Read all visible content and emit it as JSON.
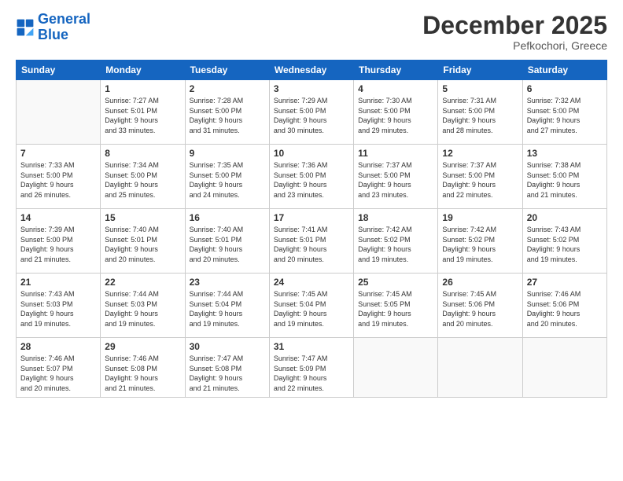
{
  "logo": {
    "line1": "General",
    "line2": "Blue"
  },
  "title": "December 2025",
  "location": "Pefkochori, Greece",
  "days_header": [
    "Sunday",
    "Monday",
    "Tuesday",
    "Wednesday",
    "Thursday",
    "Friday",
    "Saturday"
  ],
  "weeks": [
    [
      {
        "day": "",
        "info": ""
      },
      {
        "day": "1",
        "info": "Sunrise: 7:27 AM\nSunset: 5:01 PM\nDaylight: 9 hours\nand 33 minutes."
      },
      {
        "day": "2",
        "info": "Sunrise: 7:28 AM\nSunset: 5:00 PM\nDaylight: 9 hours\nand 31 minutes."
      },
      {
        "day": "3",
        "info": "Sunrise: 7:29 AM\nSunset: 5:00 PM\nDaylight: 9 hours\nand 30 minutes."
      },
      {
        "day": "4",
        "info": "Sunrise: 7:30 AM\nSunset: 5:00 PM\nDaylight: 9 hours\nand 29 minutes."
      },
      {
        "day": "5",
        "info": "Sunrise: 7:31 AM\nSunset: 5:00 PM\nDaylight: 9 hours\nand 28 minutes."
      },
      {
        "day": "6",
        "info": "Sunrise: 7:32 AM\nSunset: 5:00 PM\nDaylight: 9 hours\nand 27 minutes."
      }
    ],
    [
      {
        "day": "7",
        "info": "Sunrise: 7:33 AM\nSunset: 5:00 PM\nDaylight: 9 hours\nand 26 minutes."
      },
      {
        "day": "8",
        "info": "Sunrise: 7:34 AM\nSunset: 5:00 PM\nDaylight: 9 hours\nand 25 minutes."
      },
      {
        "day": "9",
        "info": "Sunrise: 7:35 AM\nSunset: 5:00 PM\nDaylight: 9 hours\nand 24 minutes."
      },
      {
        "day": "10",
        "info": "Sunrise: 7:36 AM\nSunset: 5:00 PM\nDaylight: 9 hours\nand 23 minutes."
      },
      {
        "day": "11",
        "info": "Sunrise: 7:37 AM\nSunset: 5:00 PM\nDaylight: 9 hours\nand 23 minutes."
      },
      {
        "day": "12",
        "info": "Sunrise: 7:37 AM\nSunset: 5:00 PM\nDaylight: 9 hours\nand 22 minutes."
      },
      {
        "day": "13",
        "info": "Sunrise: 7:38 AM\nSunset: 5:00 PM\nDaylight: 9 hours\nand 21 minutes."
      }
    ],
    [
      {
        "day": "14",
        "info": "Sunrise: 7:39 AM\nSunset: 5:00 PM\nDaylight: 9 hours\nand 21 minutes."
      },
      {
        "day": "15",
        "info": "Sunrise: 7:40 AM\nSunset: 5:01 PM\nDaylight: 9 hours\nand 20 minutes."
      },
      {
        "day": "16",
        "info": "Sunrise: 7:40 AM\nSunset: 5:01 PM\nDaylight: 9 hours\nand 20 minutes."
      },
      {
        "day": "17",
        "info": "Sunrise: 7:41 AM\nSunset: 5:01 PM\nDaylight: 9 hours\nand 20 minutes."
      },
      {
        "day": "18",
        "info": "Sunrise: 7:42 AM\nSunset: 5:02 PM\nDaylight: 9 hours\nand 19 minutes."
      },
      {
        "day": "19",
        "info": "Sunrise: 7:42 AM\nSunset: 5:02 PM\nDaylight: 9 hours\nand 19 minutes."
      },
      {
        "day": "20",
        "info": "Sunrise: 7:43 AM\nSunset: 5:02 PM\nDaylight: 9 hours\nand 19 minutes."
      }
    ],
    [
      {
        "day": "21",
        "info": "Sunrise: 7:43 AM\nSunset: 5:03 PM\nDaylight: 9 hours\nand 19 minutes."
      },
      {
        "day": "22",
        "info": "Sunrise: 7:44 AM\nSunset: 5:03 PM\nDaylight: 9 hours\nand 19 minutes."
      },
      {
        "day": "23",
        "info": "Sunrise: 7:44 AM\nSunset: 5:04 PM\nDaylight: 9 hours\nand 19 minutes."
      },
      {
        "day": "24",
        "info": "Sunrise: 7:45 AM\nSunset: 5:04 PM\nDaylight: 9 hours\nand 19 minutes."
      },
      {
        "day": "25",
        "info": "Sunrise: 7:45 AM\nSunset: 5:05 PM\nDaylight: 9 hours\nand 19 minutes."
      },
      {
        "day": "26",
        "info": "Sunrise: 7:45 AM\nSunset: 5:06 PM\nDaylight: 9 hours\nand 20 minutes."
      },
      {
        "day": "27",
        "info": "Sunrise: 7:46 AM\nSunset: 5:06 PM\nDaylight: 9 hours\nand 20 minutes."
      }
    ],
    [
      {
        "day": "28",
        "info": "Sunrise: 7:46 AM\nSunset: 5:07 PM\nDaylight: 9 hours\nand 20 minutes."
      },
      {
        "day": "29",
        "info": "Sunrise: 7:46 AM\nSunset: 5:08 PM\nDaylight: 9 hours\nand 21 minutes."
      },
      {
        "day": "30",
        "info": "Sunrise: 7:47 AM\nSunset: 5:08 PM\nDaylight: 9 hours\nand 21 minutes."
      },
      {
        "day": "31",
        "info": "Sunrise: 7:47 AM\nSunset: 5:09 PM\nDaylight: 9 hours\nand 22 minutes."
      },
      {
        "day": "",
        "info": ""
      },
      {
        "day": "",
        "info": ""
      },
      {
        "day": "",
        "info": ""
      }
    ]
  ]
}
